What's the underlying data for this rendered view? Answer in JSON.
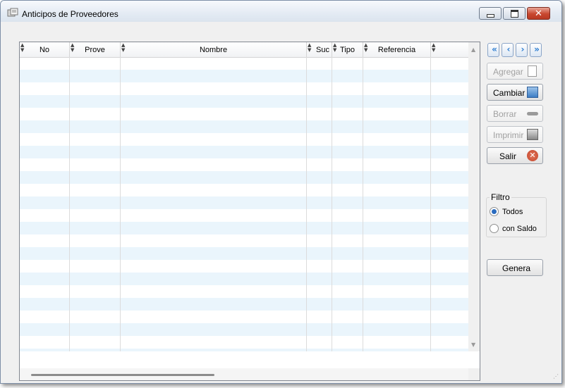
{
  "window": {
    "title": "Anticipos de Proveedores"
  },
  "grid": {
    "columns": [
      {
        "label": "No"
      },
      {
        "label": "Prove"
      },
      {
        "label": "Nombre"
      },
      {
        "label": "Suc"
      },
      {
        "label": "Tipo"
      },
      {
        "label": "Referencia"
      },
      {
        "label": ""
      }
    ],
    "rows": []
  },
  "toolbar": {
    "first_label": "«",
    "prev_label": "‹",
    "next_label": "›",
    "last_label": "»",
    "agregar": "Agregar",
    "cambiar": "Cambiar",
    "borrar": "Borrar",
    "imprimir": "Imprimir",
    "salir": "Salir"
  },
  "filtro": {
    "legend": "Filtro",
    "options": [
      {
        "label": "Todos",
        "selected": true
      },
      {
        "label": "con Saldo",
        "selected": false
      }
    ]
  },
  "genera_label": "Genera",
  "colors": {
    "row_alt": "#eaf5fc",
    "accent": "#2a7bd0",
    "close": "#c3442b"
  }
}
